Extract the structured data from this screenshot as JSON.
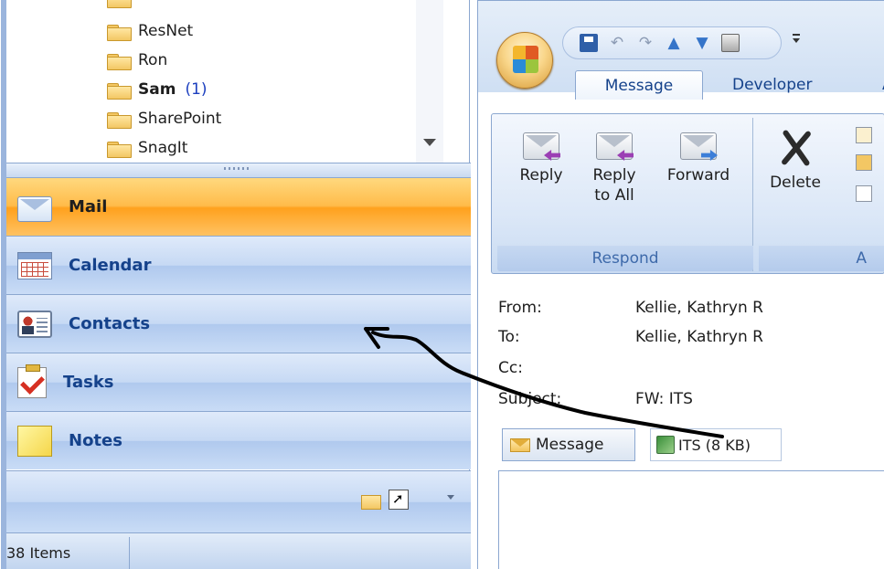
{
  "folders": [
    {
      "name": "ResNet",
      "unread": ""
    },
    {
      "name": "Ron",
      "unread": ""
    },
    {
      "name": "Sam",
      "unread": "(1)"
    },
    {
      "name": "SharePoint",
      "unread": ""
    },
    {
      "name": "SnagIt",
      "unread": ""
    }
  ],
  "nav": {
    "mail": "Mail",
    "calendar": "Calendar",
    "contacts": "Contacts",
    "tasks": "Tasks",
    "notes": "Notes"
  },
  "status": {
    "items": "38 Items"
  },
  "icons": {
    "office_button": "office-logo-icon",
    "qat": [
      "save-icon",
      "undo-icon",
      "redo-icon",
      "previous-item-icon",
      "next-item-icon",
      "print-icon"
    ]
  },
  "tabs": {
    "message": "Message",
    "developer": "Developer",
    "next": "A"
  },
  "ribbon": {
    "reply": "Reply",
    "reply_all_1": "Reply",
    "reply_all_2": "to All",
    "forward": "Forward",
    "delete": "Delete",
    "respond_group": "Respond",
    "actions_group": "A"
  },
  "message": {
    "from_label": "From:",
    "from_value": "Kellie, Kathryn R",
    "to_label": "To:",
    "to_value": "Kellie, Kathryn R",
    "cc_label": "Cc:",
    "cc_value": "",
    "subject_label": "Subject:",
    "subject_value": "FW: ITS"
  },
  "attachments": {
    "message_tab": "Message",
    "file": "ITS (8 KB)"
  },
  "colors": {
    "nav_active": "#ffb84a",
    "nav_bg": "#c6d9f4",
    "accent_text": "#15428b",
    "annotation_arrow": "#000000"
  }
}
